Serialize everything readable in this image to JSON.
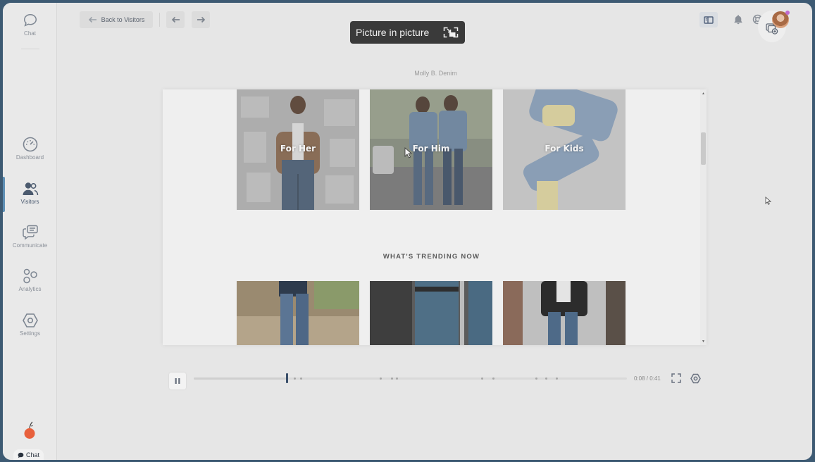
{
  "sidebar": {
    "items": [
      {
        "label": "Chat",
        "icon": "chat-bubble-icon"
      },
      {
        "label": "Dashboard",
        "icon": "gauge-icon"
      },
      {
        "label": "Visitors",
        "icon": "users-icon",
        "active": true
      },
      {
        "label": "Communicate",
        "icon": "messages-icon"
      },
      {
        "label": "Analytics",
        "icon": "analytics-icon"
      },
      {
        "label": "Settings",
        "icon": "hexagon-gear-icon"
      }
    ],
    "chat_pill": "Chat",
    "logo": "apple-logo"
  },
  "toolbar": {
    "back_label": "Back to Visitors",
    "pip_tooltip": "Picture in picture"
  },
  "replay": {
    "site_name": "Molly B. Denim",
    "tiles_top": [
      {
        "label": "For Her"
      },
      {
        "label": "For Him"
      },
      {
        "label": "For Kids"
      }
    ],
    "section_heading": "WHAT'S TRENDING NOW"
  },
  "player": {
    "time": "0:08 / 0:41",
    "progress": 0.215,
    "events": [
      0.231,
      0.246,
      0.429,
      0.455,
      0.466,
      0.663,
      0.69,
      0.788,
      0.812,
      0.836
    ]
  },
  "colors": {
    "accent": "#5e8fb5",
    "brand_orange": "#e8603c",
    "tooltip_bg": "#3a3a3a"
  }
}
